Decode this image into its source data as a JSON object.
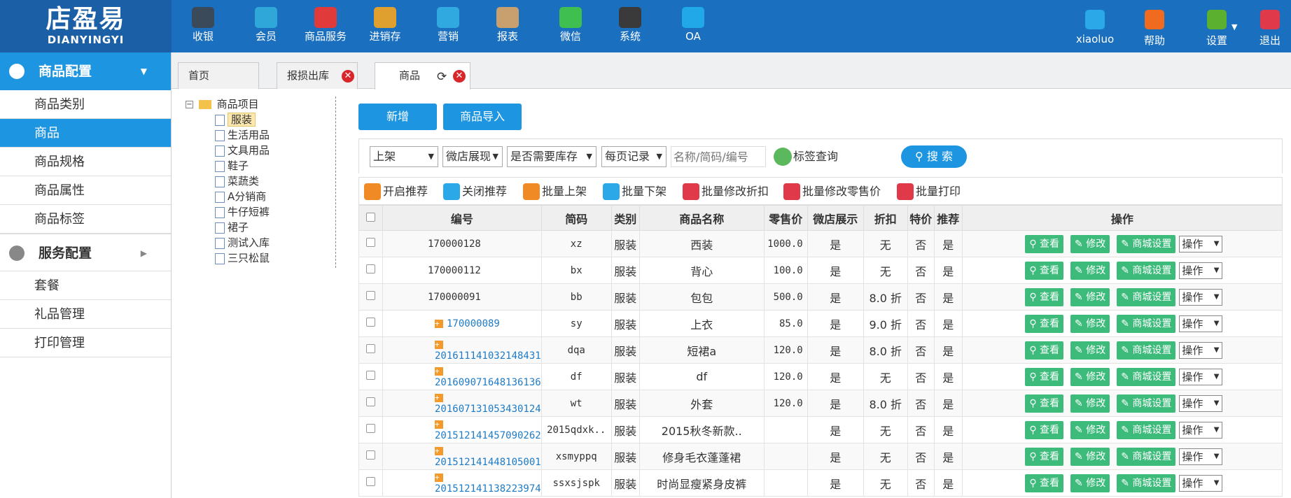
{
  "brand": {
    "name_cn": "店盈易",
    "name_en": "DIANYINGYI"
  },
  "nav": [
    {
      "label": "收银",
      "icon": "cashier-icon",
      "color": "#3a4a5a"
    },
    {
      "label": "会员",
      "icon": "member-icon",
      "color": "#2fa7d8"
    },
    {
      "label": "商品服务",
      "icon": "product-service-icon",
      "color": "#e03a3a"
    },
    {
      "label": "进销存",
      "icon": "inventory-icon",
      "color": "#e0a030"
    },
    {
      "label": "营销",
      "icon": "marketing-icon",
      "color": "#30a8e0"
    },
    {
      "label": "报表",
      "icon": "report-icon",
      "color": "#c8a070"
    },
    {
      "label": "微信",
      "icon": "wechat-icon",
      "color": "#3fbf4f"
    },
    {
      "label": "系统",
      "icon": "system-icon",
      "color": "#3a3a3a"
    },
    {
      "label": "OA",
      "icon": "oa-icon",
      "color": "#20a8e8"
    }
  ],
  "right_nav": [
    {
      "label": "xiaoluo",
      "icon": "user-icon",
      "color": "#2aa8e8"
    },
    {
      "label": "帮助",
      "icon": "bell-icon",
      "color": "#f06a20"
    },
    {
      "label": "设置",
      "icon": "settings-icon",
      "color": "#5cb030"
    },
    {
      "label": "退出",
      "icon": "logout-icon",
      "color": "#e03a4a"
    }
  ],
  "sidebar": {
    "section1": "商品配置",
    "items1": [
      "商品类别",
      "商品",
      "商品规格",
      "商品属性",
      "商品标签"
    ],
    "active_index": 1,
    "section2": "服务配置",
    "items2": [
      "套餐",
      "礼品管理",
      "打印管理"
    ]
  },
  "tabs": [
    {
      "label": "首页",
      "closable": false
    },
    {
      "label": "报损出库",
      "closable": true
    },
    {
      "label": "商品",
      "closable": true,
      "active": true
    }
  ],
  "tree": {
    "root": "商品项目",
    "children": [
      "服装",
      "生活用品",
      "文具用品",
      "鞋子",
      "菜蔬类",
      "A分销商",
      "牛仔短裤",
      "裙子",
      "测试入库",
      "三只松鼠"
    ],
    "selected": "服装"
  },
  "buttons": {
    "add": "新增",
    "import": "商品导入"
  },
  "filters": {
    "status": "上架",
    "display": "微店展现",
    "stock": "是否需要库存",
    "per_page": "每页记录",
    "search_placeholder": "名称/简码/编号",
    "tag_query": "标签查询",
    "search": "搜 索"
  },
  "toolbar": [
    {
      "label": "开启推荐",
      "icon": "recommend-on-icon",
      "color": "#f08a24"
    },
    {
      "label": "关闭推荐",
      "icon": "recommend-off-icon",
      "color": "#2aa8e8"
    },
    {
      "label": "批量上架",
      "icon": "batch-list-icon",
      "color": "#f08a24"
    },
    {
      "label": "批量下架",
      "icon": "batch-delist-icon",
      "color": "#2aa8e8"
    },
    {
      "label": "批量修改折扣",
      "icon": "batch-discount-icon",
      "color": "#e03a4a"
    },
    {
      "label": "批量修改零售价",
      "icon": "batch-price-icon",
      "color": "#e03a4a"
    },
    {
      "label": "批量打印",
      "icon": "batch-print-icon",
      "color": "#e03a4a"
    }
  ],
  "table": {
    "headers": [
      "编号",
      "简码",
      "类别",
      "商品名称",
      "零售价",
      "微店展示",
      "折扣",
      "特价",
      "推荐",
      "操作"
    ],
    "actions": {
      "view": "查看",
      "edit": "修改",
      "mall": "商城设置",
      "op": "操作"
    },
    "rows": [
      {
        "code": "170000128",
        "expand": false,
        "short": "xz",
        "cat": "服装",
        "name": "西装",
        "price": "1000.0",
        "show": "是",
        "discount": "无",
        "special": "否",
        "recommend": "是"
      },
      {
        "code": "170000112",
        "expand": false,
        "short": "bx",
        "cat": "服装",
        "name": "背心",
        "price": "100.0",
        "show": "是",
        "discount": "无",
        "special": "否",
        "recommend": "是"
      },
      {
        "code": "170000091",
        "expand": false,
        "short": "bb",
        "cat": "服装",
        "name": "包包",
        "price": "500.0",
        "show": "是",
        "discount": "8.0 折",
        "special": "否",
        "recommend": "是"
      },
      {
        "code": "170000089",
        "expand": true,
        "short": "sy",
        "cat": "服装",
        "name": "上衣",
        "price": "85.0",
        "show": "是",
        "discount": "9.0 折",
        "special": "否",
        "recommend": "是"
      },
      {
        "code": "201611141032148431",
        "expand": true,
        "short": "dqa",
        "cat": "服装",
        "name": "短裙a",
        "price": "120.0",
        "show": "是",
        "discount": "8.0 折",
        "special": "否",
        "recommend": "是"
      },
      {
        "code": "201609071648136136",
        "expand": true,
        "short": "df",
        "cat": "服装",
        "name": "df",
        "price": "120.0",
        "show": "是",
        "discount": "无",
        "special": "否",
        "recommend": "是"
      },
      {
        "code": "201607131053430124",
        "expand": true,
        "short": "wt",
        "cat": "服装",
        "name": "外套",
        "price": "120.0",
        "show": "是",
        "discount": "8.0 折",
        "special": "否",
        "recommend": "是"
      },
      {
        "code": "201512141457090262",
        "expand": true,
        "short": "2015qdxk..",
        "cat": "服装",
        "name": "2015秋冬新款..",
        "price": "",
        "show": "是",
        "discount": "无",
        "special": "否",
        "recommend": "是"
      },
      {
        "code": "201512141448105001",
        "expand": true,
        "short": "xsmyppq",
        "cat": "服装",
        "name": "修身毛衣蓬蓬裙",
        "price": "",
        "show": "是",
        "discount": "无",
        "special": "否",
        "recommend": "是"
      },
      {
        "code": "201512141138223974",
        "expand": true,
        "short": "ssxsjspk",
        "cat": "服装",
        "name": "时尚显瘦紧身皮裤",
        "price": "",
        "show": "是",
        "discount": "无",
        "special": "否",
        "recommend": "是"
      }
    ]
  }
}
